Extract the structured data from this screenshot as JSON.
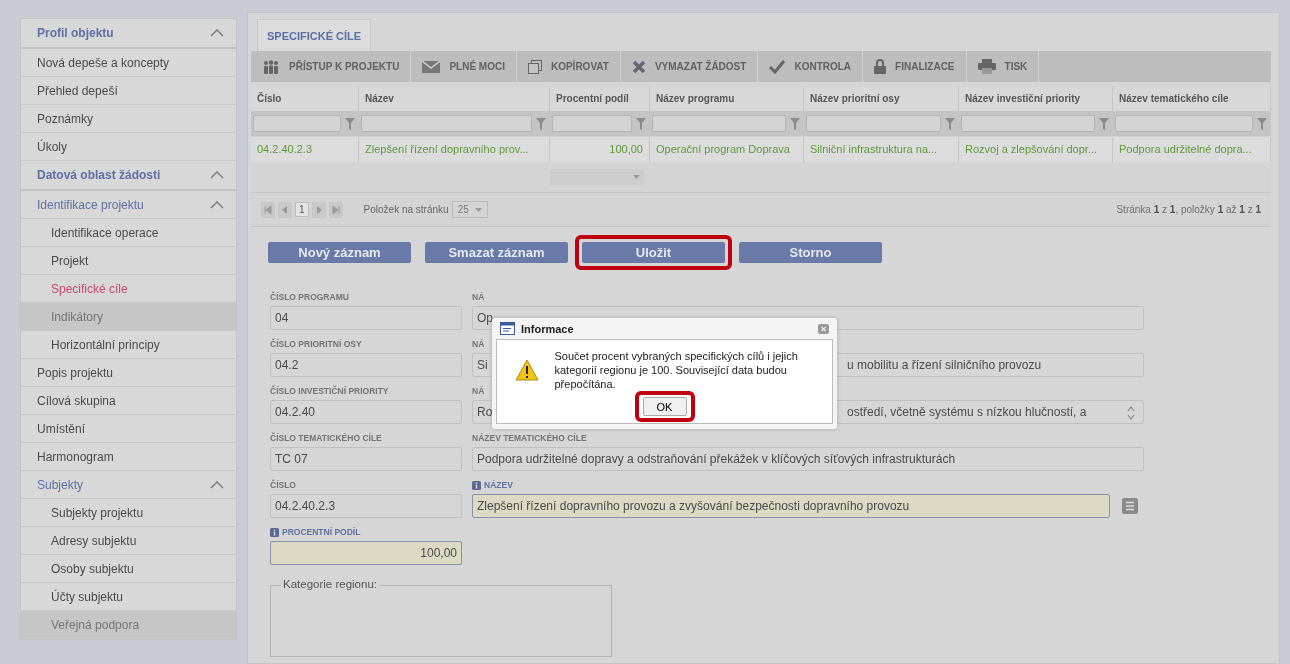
{
  "sidebar": [
    {
      "label": "Profil objektu",
      "expanded": true,
      "children": [
        {
          "label": "Nová depeše a koncepty",
          "selected": false,
          "disabled": false
        },
        {
          "label": "Přehled depeší",
          "selected": false,
          "disabled": false
        },
        {
          "label": "Poznámky",
          "selected": false,
          "disabled": false
        },
        {
          "label": "Úkoly",
          "selected": false,
          "disabled": false
        }
      ]
    },
    {
      "label": "Datová oblast žádosti",
      "expanded": true,
      "children": [
        {
          "label": "Identifikace projektu",
          "expanded": true,
          "children": [
            {
              "label": "Identifikace operace",
              "selected": false,
              "disabled": false
            },
            {
              "label": "Projekt",
              "selected": false,
              "disabled": false
            },
            {
              "label": "Specifické cíle",
              "selected": true,
              "disabled": false
            },
            {
              "label": "Indikátory",
              "selected": false,
              "disabled": true
            },
            {
              "label": "Horizontální principy",
              "selected": false,
              "disabled": false
            }
          ]
        },
        {
          "label": "Popis projektu",
          "selected": false,
          "disabled": false
        },
        {
          "label": "Cílová skupina",
          "selected": false,
          "disabled": false
        },
        {
          "label": "Umístění",
          "selected": false,
          "disabled": false
        },
        {
          "label": "Harmonogram",
          "selected": false,
          "disabled": false
        },
        {
          "label": "Subjekty",
          "expanded": true,
          "children": [
            {
              "label": "Subjekty projektu",
              "selected": false,
              "disabled": false
            },
            {
              "label": "Adresy subjektu",
              "selected": false,
              "disabled": false
            },
            {
              "label": "Osoby subjektu",
              "selected": false,
              "disabled": false
            },
            {
              "label": "Účty subjektu",
              "selected": false,
              "disabled": false
            },
            {
              "label": "Veřejná podpora",
              "selected": false,
              "disabled": true
            }
          ]
        }
      ]
    }
  ],
  "tabs": [
    {
      "label": "SPECIFICKÉ CÍLE",
      "selected": true
    }
  ],
  "toolbar": [
    "PŘÍSTUP K PROJEKTU",
    "PLNÉ MOCI",
    "KOPÍROVAT",
    "VYMAZAT ŽÁDOST",
    "KONTROLA",
    "FINALIZACE",
    "TISK"
  ],
  "table": {
    "columns": [
      "Číslo",
      "Název",
      "Procentní podíl",
      "Název programu",
      "Název prioritní osy",
      "Název investiční priority",
      "Název tematického cíle"
    ],
    "rows": [
      {
        "cells": [
          "04.2.40.2.3",
          "Zlepšení řízení dopravního prov...",
          "100,00",
          "Operační program Doprava",
          "Silniční infrastruktura na...",
          "Rozvoj a zlepšování dopr...",
          "Podpora udržitelné dopra..."
        ]
      }
    ],
    "pager": {
      "page": "1",
      "page_size_label": "Položek na stránku",
      "page_size": "25",
      "summary": "Stránka **1** z **1**, položky **1** až **1** z **1**"
    }
  },
  "buttons": [
    {
      "label": "Nový záznam",
      "highlighted": false
    },
    {
      "label": "Smazat záznam",
      "highlighted": false
    },
    {
      "label": "Uložit",
      "highlighted": true
    },
    {
      "label": "Storno",
      "highlighted": false
    }
  ],
  "form": {
    "rows": [
      {
        "left": {
          "label": "ČÍSLO PROGRAMU",
          "value": "04",
          "required": false
        },
        "right": {
          "label": "NÁ",
          "value": "Op",
          "kind": "text",
          "required": false
        }
      },
      {
        "left": {
          "label": "ČÍSLO PRIORITNÍ OSY",
          "value": "04.2",
          "required": false
        },
        "right": {
          "label": "NÁ",
          "value": "Si",
          "value_end": "u mobilitu a řízení silničního provozu",
          "kind": "text",
          "required": false
        }
      },
      {
        "left": {
          "label": "ČÍSLO INVESTIČNÍ PRIORITY",
          "value": "04.2.40",
          "required": false
        },
        "right": {
          "label": "NÁ",
          "value": "Ro",
          "value_end": "ostředí, včetně systému s nízkou hlučností, a",
          "kind": "scroll",
          "required": false
        }
      },
      {
        "left": {
          "label": "ČÍSLO TEMATICKÉHO CÍLE",
          "value": "TC 07",
          "required": false
        },
        "right": {
          "label": "NÁZEV TEMATICKÉHO CÍLE",
          "value": "Podpora udržitelné dopravy a odstraňování překážek v klíčových síťových infrastrukturách",
          "kind": "text",
          "required": false
        }
      },
      {
        "left": {
          "label": "ČÍSLO",
          "value": "04.2.40.2.3",
          "required": false
        },
        "right": {
          "label": "NÁZEV",
          "value": "Zlepšení řízení dopravního provozu a zvyšování bezpečnosti dopravního provozu",
          "kind": "lookup",
          "required": true
        }
      }
    ],
    "percent": {
      "label": "PROCENTNÍ PODÍL",
      "value": "100,00",
      "required": true
    },
    "region_legend": "Kategorie regionu:"
  },
  "dialog": {
    "title": "Informace",
    "message": "Součet procent vybraných specifických cílů i jejich kategorií regionu je 100. Související data budou přepočítána.",
    "button": {
      "label": "OK",
      "highlighted": true
    }
  }
}
